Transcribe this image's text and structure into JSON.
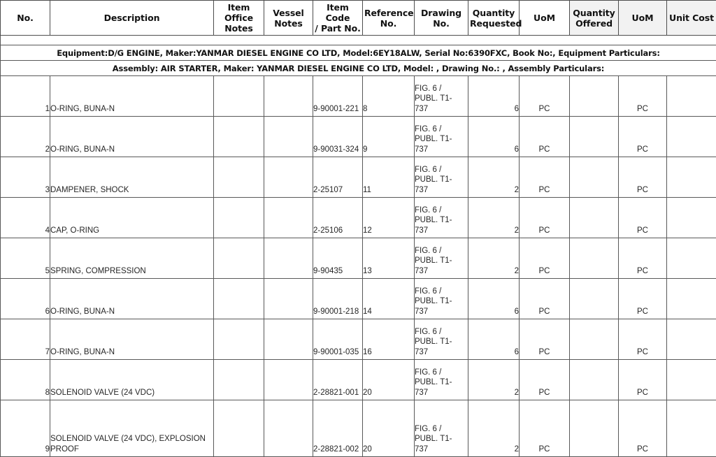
{
  "table": {
    "columns": [
      {
        "key": "no",
        "label": "No.",
        "shaded": false
      },
      {
        "key": "description",
        "label": "Description",
        "shaded": false
      },
      {
        "key": "office_notes",
        "label": "Item Office\nNotes",
        "shaded": false
      },
      {
        "key": "vessel_notes",
        "label": "Vessel\nNotes",
        "shaded": false
      },
      {
        "key": "item_code",
        "label": "Item Code\n/ Part No.",
        "shaded": false
      },
      {
        "key": "reference_no",
        "label": "Reference\nNo.",
        "shaded": false
      },
      {
        "key": "drawing_no",
        "label": "Drawing\nNo.",
        "shaded": false
      },
      {
        "key": "qty_requested",
        "label": "Quantity\nRequested",
        "shaded": false
      },
      {
        "key": "uom_requested",
        "label": "UoM",
        "shaded": false
      },
      {
        "key": "qty_offered",
        "label": "Quantity\nOffered",
        "shaded": true
      },
      {
        "key": "uom_offered",
        "label": "UoM",
        "shaded": true
      },
      {
        "key": "unit_cost",
        "label": "Unit Cost",
        "shaded": true
      }
    ],
    "header_lines": {
      "no": [
        "No."
      ],
      "description": [
        "Description"
      ],
      "office_notes": [
        "Item Office",
        "Notes"
      ],
      "vessel_notes": [
        "Vessel",
        "Notes"
      ],
      "item_code": [
        "Item Code",
        "/ Part No."
      ],
      "reference_no": [
        "Reference",
        "No."
      ],
      "drawing_no": [
        "Drawing",
        "No."
      ],
      "qty_requested": [
        "Quantity",
        "Requested"
      ],
      "uom_requested": [
        "UoM"
      ],
      "qty_offered": [
        "Quantity",
        "Offered"
      ],
      "uom_offered": [
        "UoM"
      ],
      "unit_cost": [
        "Unit Cost"
      ]
    },
    "group_rows": [
      {
        "name": "equipment-row",
        "text": "Equipment:D/G ENGINE, Maker:YANMAR DIESEL ENGINE CO LTD, Model:6EY18ALW, Serial No:6390FXC, Book No:, Equipment Particulars:"
      },
      {
        "name": "assembly-row",
        "text": "Assembly: AIR STARTER, Maker: YANMAR DIESEL ENGINE CO LTD, Model: , Drawing No.: , Assembly Particulars:"
      }
    ],
    "rows": [
      {
        "no": "1",
        "description": "O-RING, BUNA-N",
        "office_notes": "",
        "vessel_notes": "",
        "item_code": "9-90001-221",
        "reference_no": "8",
        "drawing_no_lines": [
          "FIG. 6 /",
          "PUBL. T1-",
          "737"
        ],
        "qty_requested": "6",
        "uom_requested": "PC",
        "qty_offered": "",
        "uom_offered": "PC",
        "unit_cost": "",
        "tall": false
      },
      {
        "no": "2",
        "description": "O-RING, BUNA-N",
        "office_notes": "",
        "vessel_notes": "",
        "item_code": "9-90031-324",
        "reference_no": "9",
        "drawing_no_lines": [
          "FIG. 6 /",
          "PUBL. T1-",
          "737"
        ],
        "qty_requested": "6",
        "uom_requested": "PC",
        "qty_offered": "",
        "uom_offered": "PC",
        "unit_cost": "",
        "tall": false
      },
      {
        "no": "3",
        "description": "DAMPENER, SHOCK",
        "office_notes": "",
        "vessel_notes": "",
        "item_code": "2-25107",
        "reference_no": "11",
        "drawing_no_lines": [
          "FIG. 6 /",
          "PUBL. T1-",
          "737"
        ],
        "qty_requested": "2",
        "uom_requested": "PC",
        "qty_offered": "",
        "uom_offered": "PC",
        "unit_cost": "",
        "tall": false
      },
      {
        "no": "4",
        "description": "CAP, O-RING",
        "office_notes": "",
        "vessel_notes": "",
        "item_code": "2-25106",
        "reference_no": "12",
        "drawing_no_lines": [
          "FIG. 6 /",
          "PUBL. T1-",
          "737"
        ],
        "qty_requested": "2",
        "uom_requested": "PC",
        "qty_offered": "",
        "uom_offered": "PC",
        "unit_cost": "",
        "tall": false
      },
      {
        "no": "5",
        "description": "SPRING, COMPRESSION",
        "office_notes": "",
        "vessel_notes": "",
        "item_code": "9-90435",
        "reference_no": "13",
        "drawing_no_lines": [
          "FIG. 6 /",
          "PUBL. T1-",
          "737"
        ],
        "qty_requested": "2",
        "uom_requested": "PC",
        "qty_offered": "",
        "uom_offered": "PC",
        "unit_cost": "",
        "tall": false
      },
      {
        "no": "6",
        "description": "O-RING, BUNA-N",
        "office_notes": "",
        "vessel_notes": "",
        "item_code": "9-90001-218",
        "reference_no": "14",
        "drawing_no_lines": [
          "FIG. 6 /",
          "PUBL. T1-",
          "737"
        ],
        "qty_requested": "6",
        "uom_requested": "PC",
        "qty_offered": "",
        "uom_offered": "PC",
        "unit_cost": "",
        "tall": false
      },
      {
        "no": "7",
        "description": "O-RING, BUNA-N",
        "office_notes": "",
        "vessel_notes": "",
        "item_code": "9-90001-035",
        "reference_no": "16",
        "drawing_no_lines": [
          "FIG. 6 /",
          "PUBL. T1-",
          "737"
        ],
        "qty_requested": "6",
        "uom_requested": "PC",
        "qty_offered": "",
        "uom_offered": "PC",
        "unit_cost": "",
        "tall": false
      },
      {
        "no": "8",
        "description": "SOLENOID VALVE (24 VDC)",
        "office_notes": "",
        "vessel_notes": "",
        "item_code": "2-28821-001",
        "reference_no": "20",
        "drawing_no_lines": [
          "FIG. 6 /",
          "PUBL. T1-",
          "737"
        ],
        "qty_requested": "2",
        "uom_requested": "PC",
        "qty_offered": "",
        "uom_offered": "PC",
        "unit_cost": "",
        "tall": false
      },
      {
        "no": "9",
        "description": "SOLENOID VALVE (24 VDC), EXPLOSION PROOF",
        "office_notes": "",
        "vessel_notes": "",
        "item_code": "2-28821-002",
        "reference_no": "20",
        "drawing_no_lines": [
          "FIG. 6 /",
          "PUBL. T1-",
          "737"
        ],
        "qty_requested": "2",
        "uom_requested": "PC",
        "qty_offered": "",
        "uom_offered": "PC",
        "unit_cost": "",
        "tall": true
      }
    ]
  },
  "colors": {
    "grid_line": "#595959",
    "header_shaded_bg": "#f2f2f2",
    "header_text": "#111111",
    "body_text": "#262626",
    "page_bg": "#ffffff"
  }
}
